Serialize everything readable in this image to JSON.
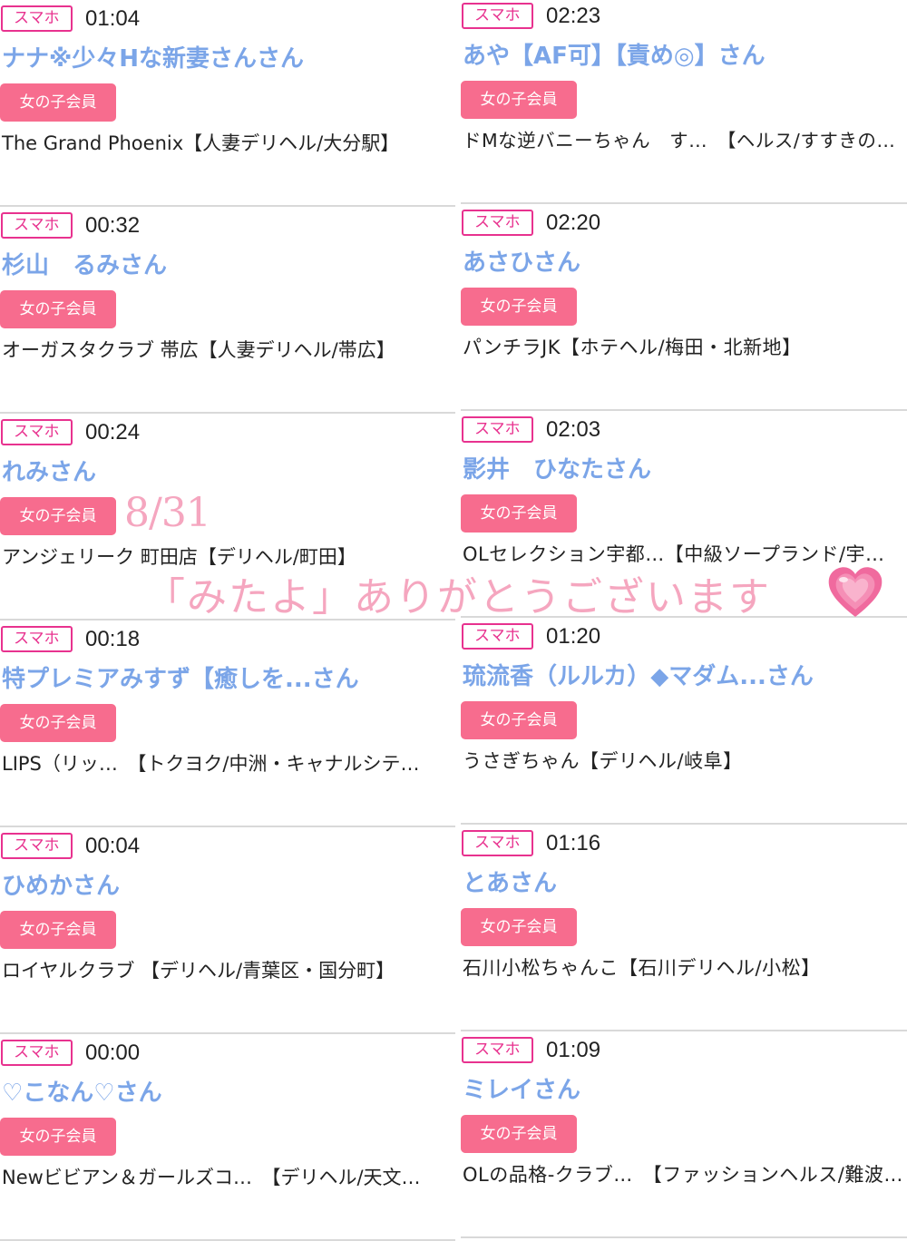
{
  "left_column": [
    {
      "device": "スマホ",
      "time": "01:04",
      "name": "ナナ※少々Hな新妻さんさん",
      "badge": "女の子会員",
      "shop": "The Grand Phoenix【人妻デリヘル/大分駅】"
    },
    {
      "device": "スマホ",
      "time": "00:32",
      "name": "杉山　るみさん",
      "badge": "女の子会員",
      "shop": "オーガスタクラブ 帯広【人妻デリヘル/帯広】"
    },
    {
      "device": "スマホ",
      "time": "00:24",
      "name": "れみさん",
      "badge": "女の子会員",
      "shop": "アンジェリーク 町田店【デリヘル/町田】"
    },
    {
      "device": "スマホ",
      "time": "00:18",
      "name": "特プレミアみすず【癒しを...さん",
      "badge": "女の子会員",
      "shop": "LIPS（リッ…　【トクヨク/中洲・キャナルシテ…"
    },
    {
      "device": "スマホ",
      "time": "00:04",
      "name": "ひめかさん",
      "badge": "女の子会員",
      "shop": "ロイヤルクラブ 【デリヘル/青葉区・国分町】"
    },
    {
      "device": "スマホ",
      "time": "00:00",
      "name": "♡こなん♡さん",
      "badge": "女の子会員",
      "shop": "Newビビアン＆ガールズコ…　【デリヘル/天文…"
    }
  ],
  "right_column": [
    {
      "device": "スマホ",
      "time": "02:23",
      "name": "あや【AF可】【責め◎】さん",
      "badge": "女の子会員",
      "shop": "ドMな逆バニーちゃん　す…　【ヘルス/すすきの…"
    },
    {
      "device": "スマホ",
      "time": "02:20",
      "name": "あさひさん",
      "badge": "女の子会員",
      "shop": "パンチラJK【ホテヘル/梅田・北新地】"
    },
    {
      "device": "スマホ",
      "time": "02:03",
      "name": "影井　ひなたさん",
      "badge": "女の子会員",
      "shop": "OLセレクション宇都…【中級ソープランド/宇…"
    },
    {
      "device": "スマホ",
      "time": "01:20",
      "name": "琉流香（ルルカ）◆マダム...さん",
      "badge": "女の子会員",
      "shop": "うさぎちゃん【デリヘル/岐阜】"
    },
    {
      "device": "スマホ",
      "time": "01:16",
      "name": "とあさん",
      "badge": "女の子会員",
      "shop": "石川小松ちゃんこ【石川デリヘル/小松】"
    },
    {
      "device": "スマホ",
      "time": "01:09",
      "name": "ミレイさん",
      "badge": "女の子会員",
      "shop": "OLの品格-クラブ…　【ファッションヘルス/難波…"
    }
  ],
  "overlay": {
    "date": "8/31",
    "thanks": "「みたよ」ありがとうございます",
    "heart_icon": "growing-heart-icon",
    "text_color": "#f5a6bf"
  },
  "colors": {
    "device_border": "#e8328f",
    "name": "#7ba5e8",
    "badge_bg": "#f76c8e"
  }
}
